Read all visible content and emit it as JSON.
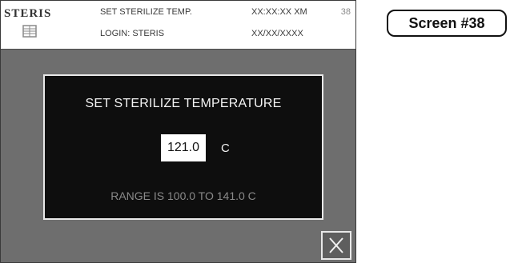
{
  "header": {
    "brand": "STERIS",
    "screen_title": "SET STERILIZE TEMP.",
    "login": "LOGIN: STERIS",
    "time": "XX:XX:XX XM",
    "date": "XX/XX/XXXX",
    "screen_number": "38"
  },
  "dialog": {
    "title": "SET STERILIZE TEMPERATURE",
    "temperature_value": "121.0",
    "temperature_unit": "C",
    "range_text": "RANGE IS 100.0 TO 141.0 C"
  },
  "close_button": {
    "label": "X"
  },
  "screen_label": "Screen #38",
  "colors": {
    "panel_background": "#6e6e6e",
    "dialog_background": "#0e0e0e",
    "dialog_border": "#e8e8e8",
    "range_text": "#8a8a8a"
  },
  "icons": {
    "logo": "steris-logo",
    "close": "close-icon"
  }
}
